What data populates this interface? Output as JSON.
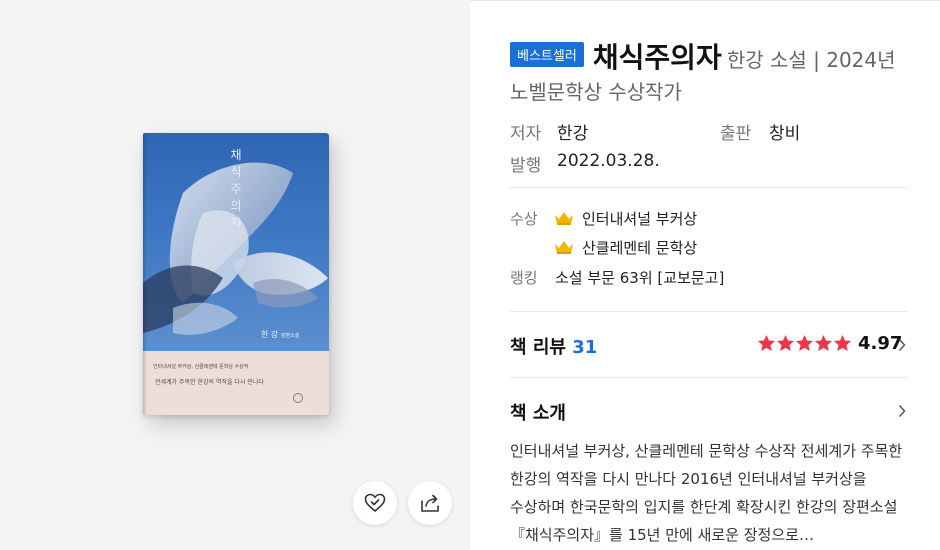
{
  "badge": "베스트셀러",
  "title": "채식주의자",
  "subtitle_line1": "한강 소설 | 2024년",
  "subtitle_line2": "노벨문학상 수상작가",
  "meta": {
    "author_label": "저자",
    "author": "한강",
    "publisher_label": "출판",
    "publisher": "창비",
    "date_label": "발행",
    "date": "2022.03.28."
  },
  "awards": {
    "label": "수상",
    "items": [
      "인터내셔널 부커상",
      "산클레멘테 문학상"
    ]
  },
  "ranking": {
    "label": "랭킹",
    "value": "소설 부문 63위 [교보문고]"
  },
  "review": {
    "label": "책 리뷰",
    "count": "31",
    "rating": "4.97",
    "stars": 5
  },
  "intro": {
    "label": "책 소개",
    "text": "인터내셔널 부커상, 산클레멘테 문학상 수상작 전세계가 주목한 한강의 역작을 다시 만나다 2016년 인터내셔널 부커상을 수상하며 한국문학의 입지를 한단계 확장시킨 한강의 장편소설 『채식주의자』를 15년 만에 새로운 장정으로…"
  },
  "cover": {
    "title": "채식주의자",
    "author": "한 강",
    "author_sub": "장편소설",
    "band_line1": "인터내셔널 부커상, 산클레멘테 문학상 수상작",
    "band_line2": "전세계가 주목한 한강의 역작을 다시 만나다"
  },
  "colors": {
    "accent": "#1d6fd8",
    "star": "#f0334e",
    "crown": "#f5b400"
  },
  "icons": {
    "wishlist": "heart-check-icon",
    "share": "share-icon",
    "crown": "crown-icon",
    "chevron": "chevron-right-icon"
  }
}
